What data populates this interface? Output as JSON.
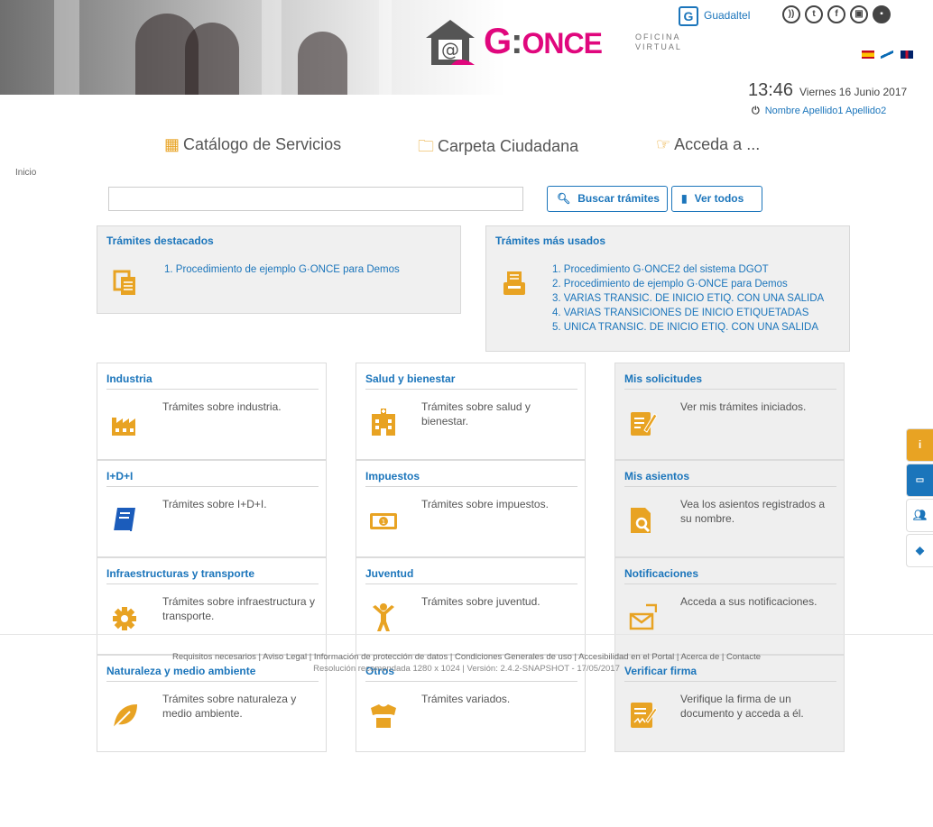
{
  "header": {
    "logo": {
      "g": "G",
      "colon": ":",
      "once": "ONCE",
      "sub1": "OFICINA",
      "sub2": "VIRTUAL"
    },
    "partner_badge": "G",
    "partner_name": "Guadaltel",
    "social_icons": [
      "rss-icon",
      "twitter-icon",
      "facebook-icon",
      "instagram-icon",
      "share-icon"
    ],
    "flags": [
      "es-flag-icon",
      "gl-flag-icon",
      "en-flag-icon"
    ],
    "time": "13:46",
    "date": "Viernes 16 Junio 2017",
    "user": "Nombre Apellido1 Apellido2"
  },
  "nav": {
    "catalog": "Catálogo de Servicios",
    "folder": "Carpeta Ciudadana",
    "access": "Acceda a ..."
  },
  "breadcrumb": "Inicio",
  "search": {
    "value": "",
    "search_button": "Buscar trámites",
    "all_button": "Ver todos"
  },
  "featured": {
    "title": "Trámites destacados",
    "items": [
      "1. Procedimiento de ejemplo G·ONCE para Demos"
    ]
  },
  "most_used": {
    "title": "Trámites más usados",
    "items": [
      "1. Procedimiento G·ONCE2 del sistema DGOT",
      "2. Procedimiento de ejemplo G·ONCE para Demos",
      "3. VARIAS TRANSIC. DE INICIO ETIQ. CON UNA SALIDA",
      "4. VARIAS TRANSICIONES DE INICIO ETIQUETADAS",
      "5. UNICA TRANSIC. DE INICIO ETIQ. CON UNA SALIDA"
    ]
  },
  "cards": [
    {
      "title": "Industria",
      "desc": "Trámites sobre industria.",
      "icon": "factory-icon"
    },
    {
      "title": "Salud y bienestar",
      "desc": "Trámites sobre salud y bienestar.",
      "icon": "hospital-icon"
    },
    {
      "title": "Mis solicitudes",
      "desc": "Ver mis trámites iniciados.",
      "icon": "edit-document-icon"
    },
    {
      "title": "I+D+I",
      "desc": "Trámites sobre I+D+I.",
      "icon": "book-icon"
    },
    {
      "title": "Impuestos",
      "desc": "Trámites sobre impuestos.",
      "icon": "money-icon"
    },
    {
      "title": "Mis asientos",
      "desc": "Vea los asientos registrados a su nombre.",
      "icon": "search-document-icon"
    },
    {
      "title": "Infraestructuras y transporte",
      "desc": "Trámites sobre infraestructura y transporte.",
      "icon": "gear-icon"
    },
    {
      "title": "Juventud",
      "desc": "Trámites sobre juventud.",
      "icon": "child-icon"
    },
    {
      "title": "Notificaciones",
      "desc": "Acceda a sus notificaciones.",
      "icon": "envelope-icon"
    },
    {
      "title": "Naturaleza y medio ambiente",
      "desc": "Trámites sobre naturaleza y medio ambiente.",
      "icon": "leaf-icon"
    },
    {
      "title": "Otros",
      "desc": "Trámites variados.",
      "icon": "shirt-icon"
    },
    {
      "title": "Verificar firma",
      "desc": "Verifique la firma de un documento y acceda a él.",
      "icon": "signature-icon"
    }
  ],
  "side_tabs": [
    "info-icon",
    "id-card-icon",
    "users-icon",
    "tag-icon"
  ],
  "footer": {
    "links": "Requisitos necesarios | Aviso Legal | Información de protección de datos | Condiciones Generales de uso | Accesibilidad en el Portal | Acerca de | Contacte",
    "version": "Resolución recomendada 1280 x 1024 | Versión: 2.4.2-SNAPSHOT - 17/05/2017"
  },
  "colors": {
    "accent": "#1b75bb",
    "icon_orange": "#e8a323",
    "brand": "#e0077d"
  }
}
